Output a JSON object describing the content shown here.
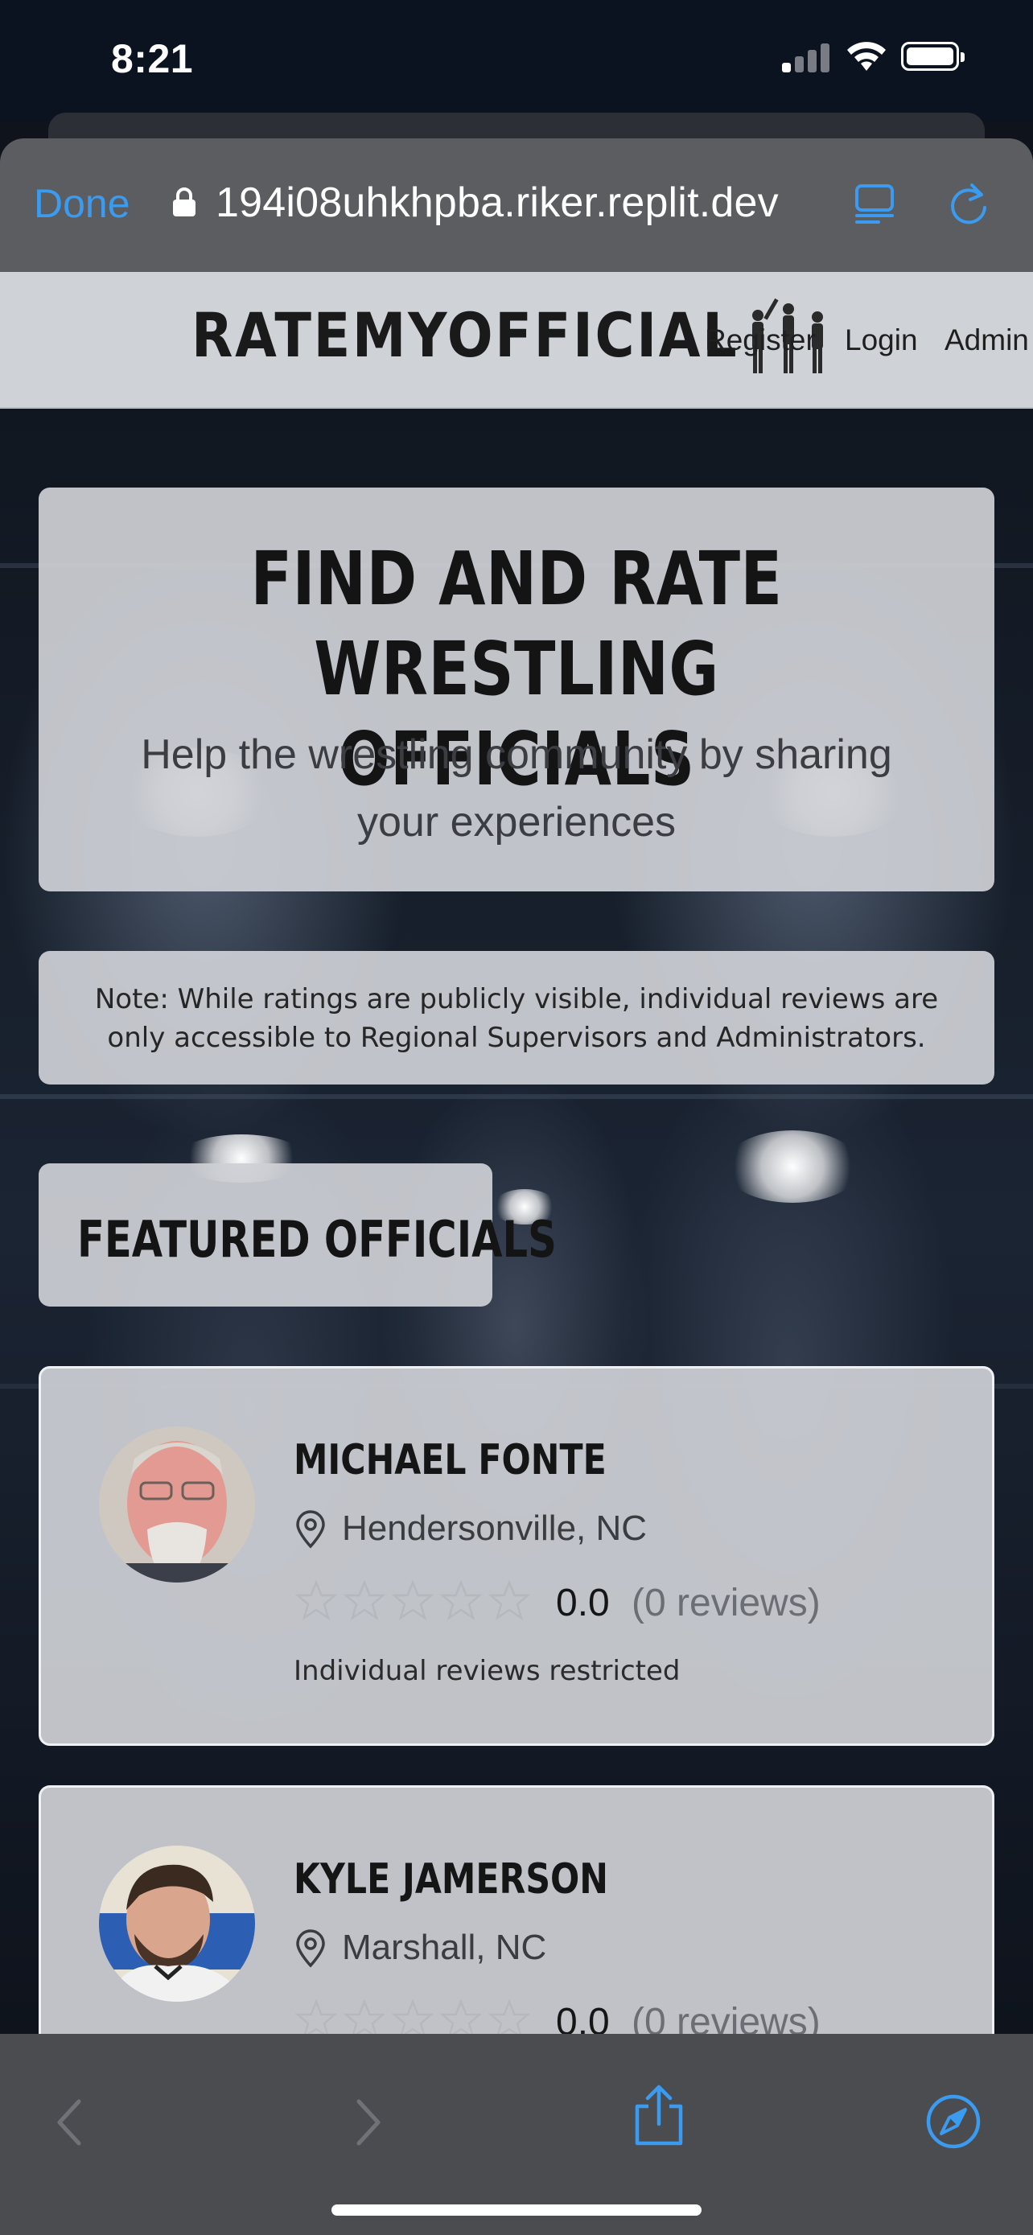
{
  "status_bar": {
    "time": "8:21"
  },
  "browser": {
    "done_label": "Done",
    "url": "194i08uhkhpba.riker.replit.dev",
    "accent_color": "#3b9bf0"
  },
  "site_nav": {
    "logo": "RATEMYOFFICIAL",
    "links": [
      {
        "label": "Register"
      },
      {
        "label": "Login"
      },
      {
        "label": "Admin"
      }
    ]
  },
  "hero": {
    "title_line1": "FIND AND RATE WRESTLING",
    "title_line2": "OFFICIALS",
    "subtitle": "Help the wrestling community by sharing your experiences"
  },
  "note": {
    "text": "Note: While ratings are publicly visible, individual reviews are only accessible to Regional Supervisors and Administrators."
  },
  "featured": {
    "title": "FEATURED OFFICIALS",
    "officials": [
      {
        "name": "MICHAEL FONTE",
        "location": "Hendersonville, NC",
        "rating": "0.0",
        "rating_stars": 0,
        "reviews": "(0 reviews)",
        "restricted_text": "Individual reviews restricted"
      },
      {
        "name": "KYLE JAMERSON",
        "location": "Marshall, NC",
        "rating": "0.0",
        "rating_stars": 0,
        "reviews": "(0 reviews)"
      }
    ]
  }
}
